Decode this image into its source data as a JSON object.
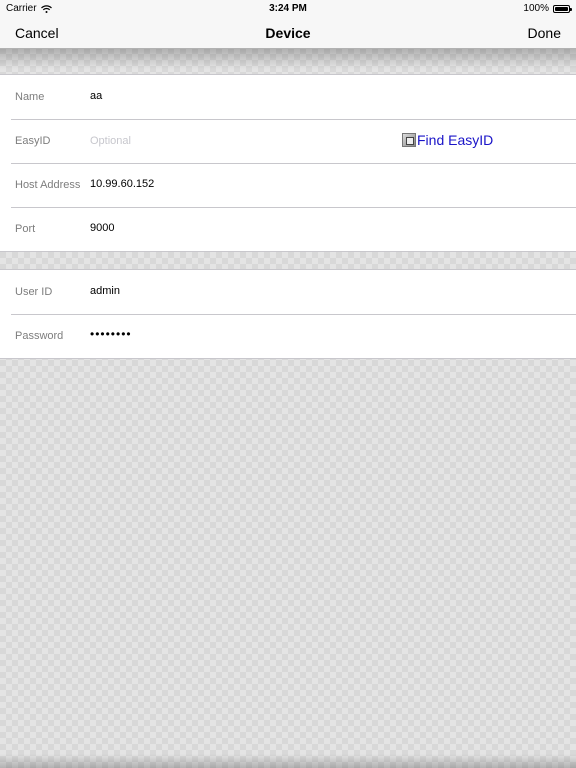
{
  "status_bar": {
    "carrier": "Carrier",
    "time": "3:24 PM",
    "battery": "100%"
  },
  "nav": {
    "cancel_label": "Cancel",
    "title": "Device",
    "done_label": "Done"
  },
  "device_section": {
    "name": {
      "label": "Name",
      "value": "aa"
    },
    "easyid": {
      "label": "EasyID",
      "placeholder": "Optional",
      "find_label": "Find EasyID"
    },
    "host": {
      "label": "Host Address",
      "value": "10.99.60.152"
    },
    "port": {
      "label": "Port",
      "value": "9000"
    }
  },
  "auth_section": {
    "user": {
      "label": "User ID",
      "value": "admin"
    },
    "password": {
      "label": "Password",
      "value": "••••••••"
    }
  },
  "colors": {
    "link": "#1a14c8",
    "label": "#7d7d7d",
    "placeholder": "#c7c7cd"
  }
}
